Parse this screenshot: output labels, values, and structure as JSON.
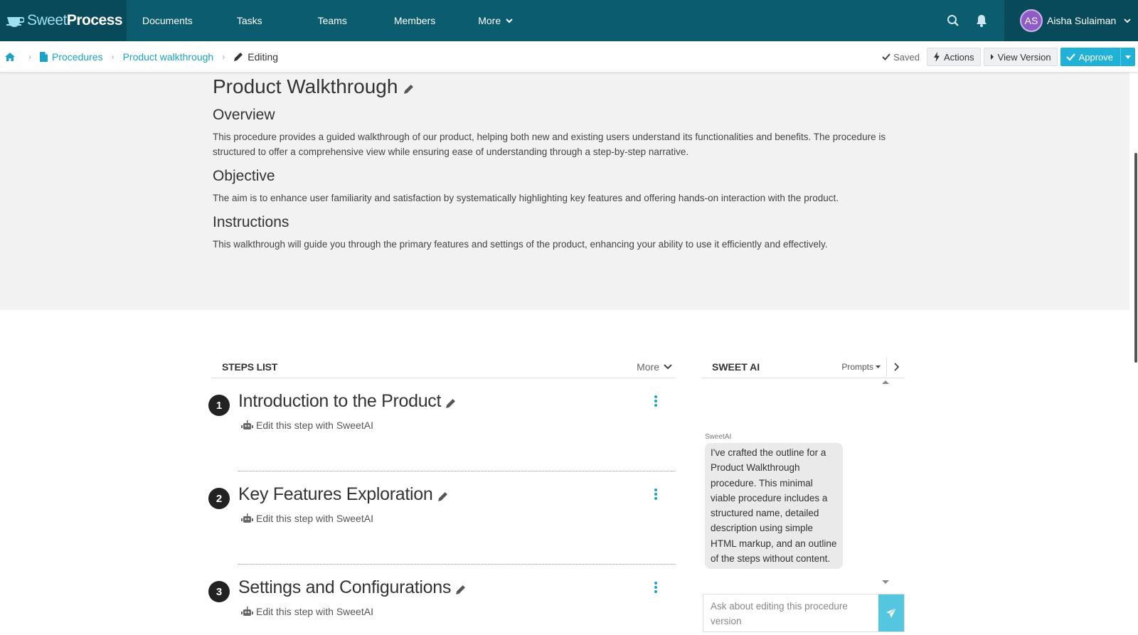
{
  "app": {
    "brand_sweet": "Sweet",
    "brand_process": "Process"
  },
  "nav": {
    "items": [
      {
        "label": "Documents"
      },
      {
        "label": "Tasks"
      },
      {
        "label": "Teams"
      },
      {
        "label": "Members"
      },
      {
        "label": "More"
      }
    ],
    "icons": [
      "search-icon",
      "bell-icon"
    ],
    "user": {
      "initials": "AS",
      "name": "Aisha Sulaiman"
    }
  },
  "breadcrumb": {
    "items": [
      {
        "label": "Procedures"
      },
      {
        "label": "Product walkthrough"
      },
      {
        "label": "Editing"
      }
    ],
    "saved_label": "Saved",
    "actions_label": "Actions",
    "view_version_label": "View Version",
    "approve_label": "Approve"
  },
  "overview": {
    "title": "Product Walkthrough",
    "sections": [
      {
        "heading": "Overview",
        "text": "This procedure provides a guided walkthrough of our product, helping both new and existing users understand its functionalities and benefits. The procedure is structured to offer a comprehensive view while ensuring ease of understanding through a step-by-step narrative."
      },
      {
        "heading": "Objective",
        "text": "The aim is to enhance user familiarity and satisfaction by systematically highlighting key features and offering hands-on interaction with the product."
      },
      {
        "heading": "Instructions",
        "text": "This walkthrough will guide you through the primary features and settings of the product, enhancing your ability to use it efficiently and effectively."
      }
    ]
  },
  "steps": {
    "title": "STEPS LIST",
    "more_label": "More",
    "items": [
      {
        "number": "1",
        "title": "Introduction to the Product",
        "ai_label": "Edit this step with SweetAI"
      },
      {
        "number": "2",
        "title": "Key Features Exploration",
        "ai_label": "Edit this step with SweetAI"
      },
      {
        "number": "3",
        "title": "Settings and Configurations",
        "ai_label": "Edit this step with SweetAI"
      }
    ]
  },
  "sweet_ai": {
    "title": "SWEET AI",
    "prompts_label": "Prompts",
    "message_sender": "SweetAI",
    "message_text": "I've crafted the outline for a Product Walkthrough procedure. This minimal viable procedure includes a structured name, detailed description using simple HTML markup, and an outline of the steps without content.",
    "input_placeholder": "Ask about editing this procedure version"
  },
  "colors": {
    "nav_bg": "#0b5c6e",
    "nav_dark": "#084a59",
    "accent": "#1aa3c4",
    "approve": "#1fb2d6"
  }
}
